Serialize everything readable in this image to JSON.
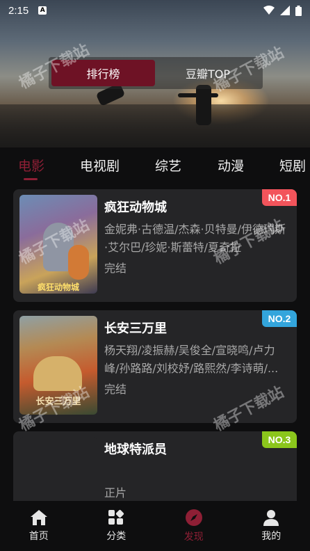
{
  "status_bar": {
    "time": "2:15",
    "notif_icon": "a-badge-icon"
  },
  "ranking_switch": {
    "active": "排行榜",
    "inactive": "豆瓣TOP"
  },
  "category_tabs": [
    "电影",
    "电视剧",
    "综艺",
    "动漫",
    "短剧"
  ],
  "items": [
    {
      "title": "疯狂动物城",
      "cast": "金妮弗·古德温/杰森·贝特曼/伊德瑞斯·艾尔巴/珍妮·斯蕾特/夏奇拉",
      "status": "完结",
      "rank": "NO.1",
      "rank_color": "#f2545b",
      "poster_text": "疯狂动物城"
    },
    {
      "title": "长安三万里",
      "cast": "杨天翔/凌振赫/吴俊全/宣晓鸣/卢力峰/孙路路/刘校妤/路熙然/李诗萌/...",
      "status": "完结",
      "rank": "NO.2",
      "rank_color": "#33a5dc",
      "poster_text": "长安三万里"
    },
    {
      "title": "地球特派员",
      "cast": "",
      "status": "正片",
      "rank": "NO.3",
      "rank_color": "#8bc61c",
      "poster_text": ""
    }
  ],
  "bottom_nav": [
    {
      "label": "首页",
      "icon": "home-icon"
    },
    {
      "label": "分类",
      "icon": "category-icon"
    },
    {
      "label": "发现",
      "icon": "compass-icon"
    },
    {
      "label": "我的",
      "icon": "user-icon"
    }
  ],
  "watermark": "橘子下载站",
  "colors": {
    "accent": "#8e1f35",
    "background": "#0e0e0f",
    "card": "#252527"
  }
}
